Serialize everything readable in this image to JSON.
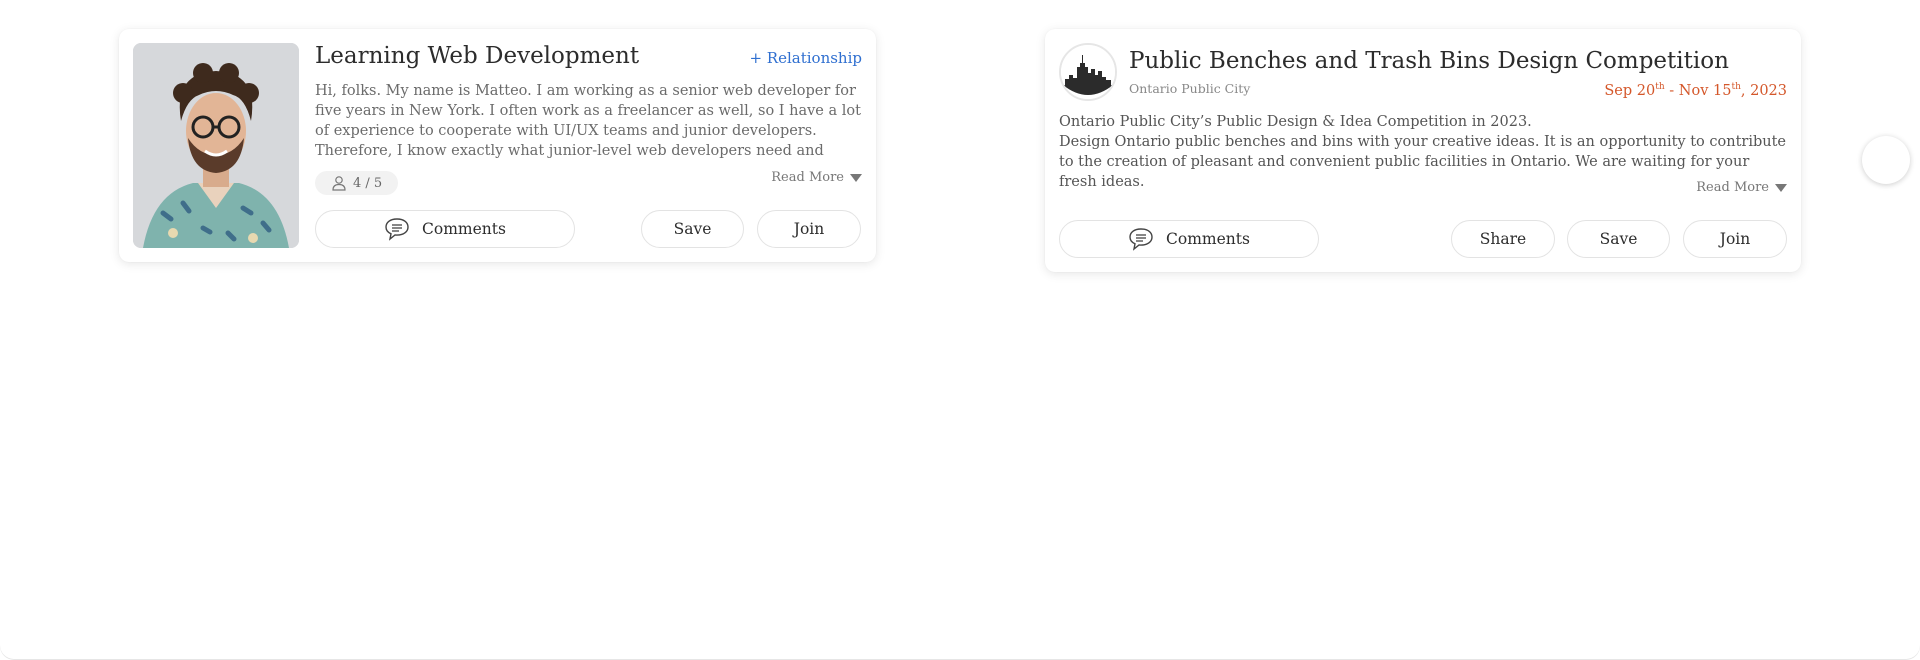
{
  "colors": {
    "accent_link": "#2f6fd0",
    "date_highlight": "#d4572a",
    "text_muted": "#6b6b6b"
  },
  "card1": {
    "title": "Learning Web Development",
    "relationship_label": "+ Relationship",
    "description": "Hi, folks. My name is Matteo. I am working as a senior web developer for five years in New York. I often work as a freelancer as well, so I have a lot of experience to cooperate with UI/UX teams and junior developers. Therefore, I know exactly what junior-level web developers need and struggle with. I am......",
    "members": "4 / 5",
    "read_more": "Read More",
    "comments_label": "Comments",
    "save_label": "Save",
    "join_label": "Join"
  },
  "card2": {
    "title": "Public Benches and Trash Bins Design Competition",
    "organization": "Ontario Public City",
    "date_start": "Sep 20",
    "date_start_suffix": "th",
    "date_sep": " - Nov 15",
    "date_end_suffix": "th",
    "date_year": ", 2023",
    "description_line1": "Ontario Public City’s Public Design & Idea Competition in 2023.",
    "description_line2": "Design Ontario public benches and bins with your creative ideas. It is an opportunity to contribute to the creation of pleasant and convenient public facilities in Ontario. We are waiting for your fresh ideas.",
    "read_more": "Read More",
    "comments_label": "Comments",
    "share_label": "Share",
    "save_label": "Save",
    "join_label": "Join"
  }
}
